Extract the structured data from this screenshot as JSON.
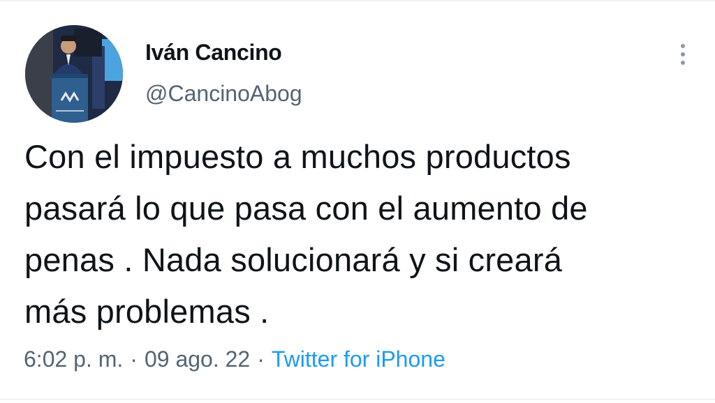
{
  "tweet": {
    "author": {
      "display_name": "Iván Cancino",
      "handle": "@CancinoAbog",
      "avatar_icon": "profile-photo-speaker-at-podium"
    },
    "more_icon": "vertical-ellipsis-icon",
    "text_lines": [
      "Con el impuesto a muchos productos",
      "pasará lo que pasa con el aumento de",
      "penas . Nada solucionará y si creará",
      "más problemas ."
    ],
    "meta": {
      "time": "6:02 p. m.",
      "separator": "·",
      "date": "09 ago. 22",
      "source": "Twitter for iPhone"
    }
  },
  "colors": {
    "text_primary": "#0f1419",
    "text_secondary": "#536471",
    "link": "#1d9bf0",
    "icon_gray": "#8b98a5",
    "divider": "#eff3f4"
  }
}
